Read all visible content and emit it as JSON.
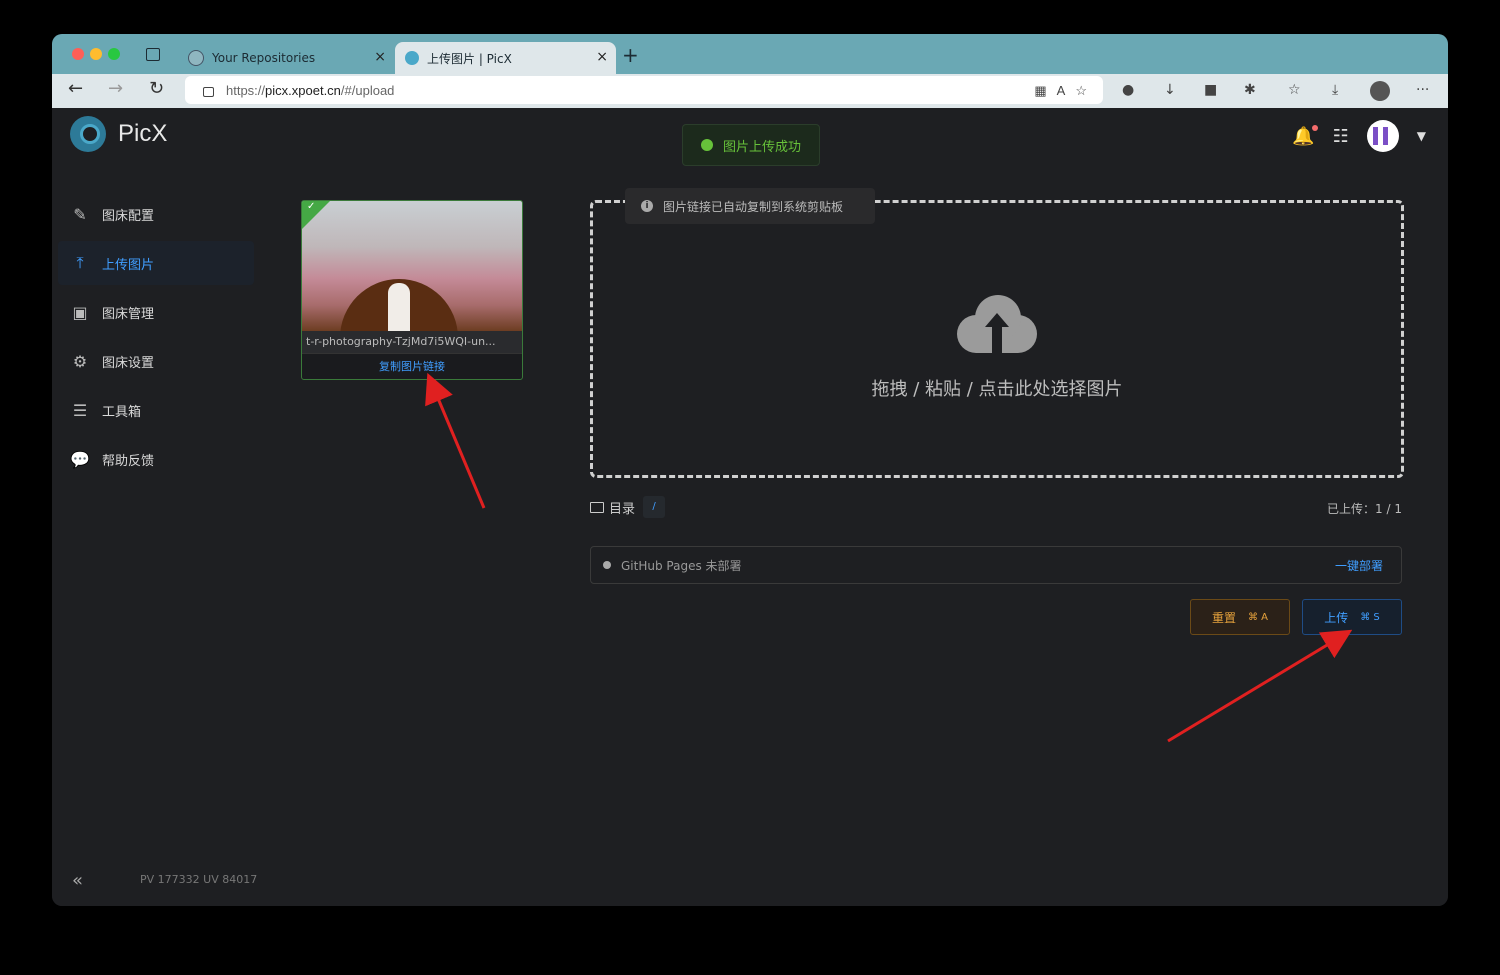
{
  "browser": {
    "tabs": [
      {
        "title": "Your Repositories"
      },
      {
        "title": "上传图片 | PicX"
      }
    ],
    "new_tab": "+",
    "tab_close": "×",
    "url_prefix": "https://",
    "url_domain": "picx.xpoet.cn",
    "url_path": "/#/upload"
  },
  "app": {
    "name": "PicX",
    "toast": "图片上传成功",
    "sidebar": {
      "items": [
        {
          "label": "图床配置",
          "icon": "edit-icon"
        },
        {
          "label": "上传图片",
          "icon": "upload-icon"
        },
        {
          "label": "图床管理",
          "icon": "image-icon"
        },
        {
          "label": "图床设置",
          "icon": "gear-icon"
        },
        {
          "label": "工具箱",
          "icon": "toolbox-icon"
        },
        {
          "label": "帮助反馈",
          "icon": "chat-icon"
        }
      ],
      "collapse": "«",
      "stats": "PV 177332  UV 84017"
    },
    "tooltip": "图片链接已自动复制到系统剪贴板",
    "card": {
      "filename": "t-r-photography-TzjMd7i5WQI-un...",
      "copy_link": "复制图片链接",
      "check": "✓"
    },
    "dropzone_text": "拖拽 / 粘贴 / 点击此处选择图片",
    "dir_label": "目录",
    "dir_path": "/",
    "uploaded": "已上传：1 / 1",
    "deploy": {
      "label": "GitHub Pages   未部署",
      "action": "一键部署"
    },
    "buttons": {
      "reset": "重置",
      "reset_kbd": "⌘ A",
      "upload": "上传",
      "upload_kbd": "⌘ S"
    }
  },
  "colors": {
    "accent": "#409eff",
    "success": "#67c23a",
    "warning": "#e6a23c",
    "annotation": "#e02020"
  }
}
